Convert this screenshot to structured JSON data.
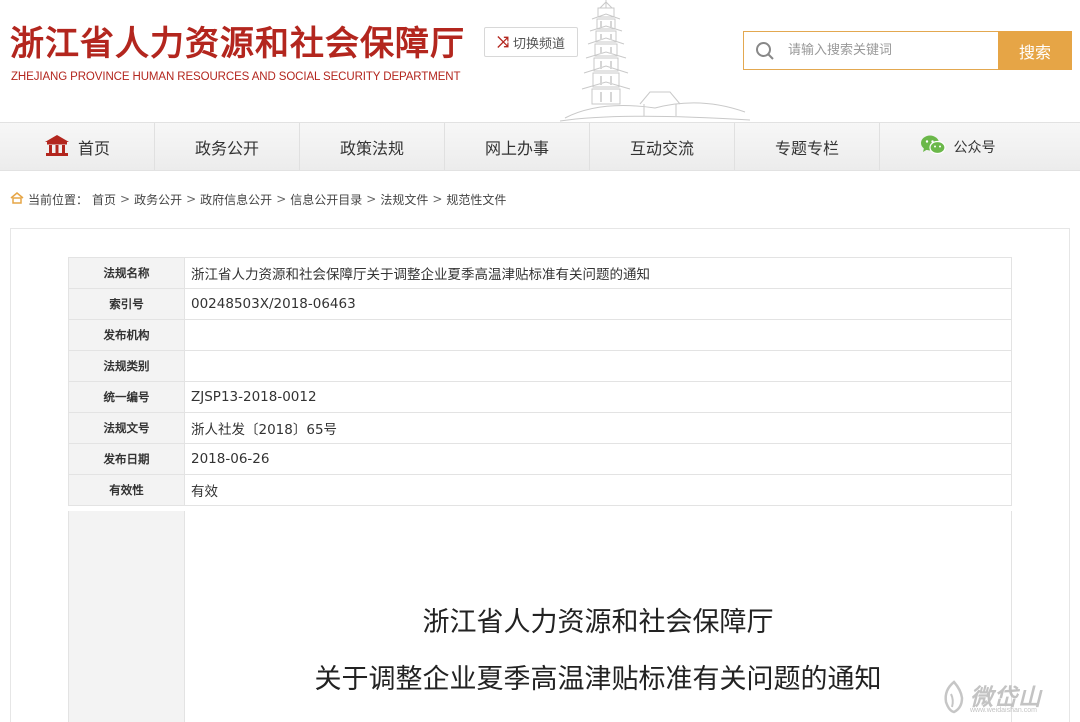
{
  "header": {
    "logo_cn": "浙江省人力资源和社会保障厅",
    "logo_en": "ZHEJIANG PROVINCE HUMAN RESOURCES AND SOCIAL SECURITY DEPARTMENT",
    "switch_label": "切换频道",
    "search_placeholder": "请输入搜索关键词",
    "search_button": "搜索",
    "brand_color": "#b3261e",
    "accent_color": "#e6a546"
  },
  "nav": {
    "items": [
      {
        "label": "首页",
        "icon": "home-icon"
      },
      {
        "label": "政务公开"
      },
      {
        "label": "政策法规"
      },
      {
        "label": "网上办事"
      },
      {
        "label": "互动交流"
      },
      {
        "label": "专题专栏"
      },
      {
        "label": "公众号",
        "icon": "wechat-icon"
      }
    ]
  },
  "breadcrumb": {
    "prefix": "当前位置：",
    "items": [
      "首页",
      "政务公开",
      "政府信息公开",
      "信息公开目录",
      "法规文件",
      "规范性文件"
    ],
    "separator": ">"
  },
  "meta": {
    "rows": [
      {
        "key": "法规名称",
        "value": "浙江省人力资源和社会保障厅关于调整企业夏季高温津贴标准有关问题的通知"
      },
      {
        "key": "索引号",
        "value": "00248503X/2018-06463"
      },
      {
        "key": "发布机构",
        "value": ""
      },
      {
        "key": "法规类别",
        "value": ""
      },
      {
        "key": "统一编号",
        "value": "ZJSP13-2018-0012"
      },
      {
        "key": "法规文号",
        "value": "浙人社发〔2018〕65号"
      },
      {
        "key": "发布日期",
        "value": "2018-06-26"
      },
      {
        "key": "有效性",
        "value": "有效"
      }
    ]
  },
  "document": {
    "title_line1": "浙江省人力资源和社会保障厅",
    "title_line2": "关于调整企业夏季高温津贴标准有关问题的通知"
  },
  "watermark": {
    "text": "微岱山",
    "url": "www.weidaishan.com"
  }
}
